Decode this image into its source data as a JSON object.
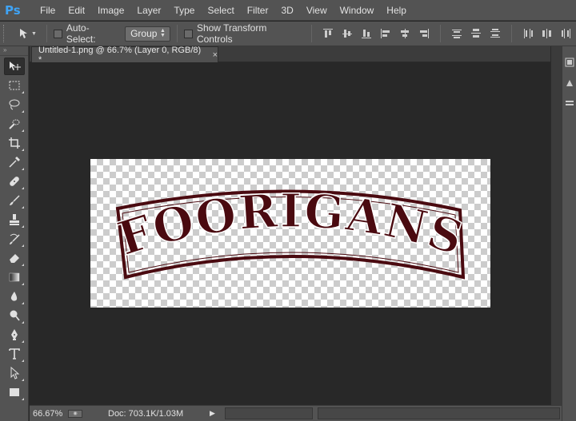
{
  "app": {
    "logo": "Ps"
  },
  "menu": [
    "File",
    "Edit",
    "Image",
    "Layer",
    "Type",
    "Select",
    "Filter",
    "3D",
    "View",
    "Window",
    "Help"
  ],
  "options": {
    "auto_select_label": "Auto-Select:",
    "auto_select_checked": false,
    "group_value": "Group",
    "transform_label": "Show Transform Controls",
    "transform_checked": false
  },
  "document": {
    "tab_title": "Untitled-1.png @ 66.7% (Layer 0, RGB/8) *",
    "close_glyph": "×",
    "artwork_text": "FOORIGANS",
    "artwork_color": "#4a0a10"
  },
  "status": {
    "zoom": "66.67%",
    "doc_info": "Doc: 703.1K/1.03M",
    "arrow": "▶"
  },
  "tools": [
    "move-tool-icon",
    "marquee-tool-icon",
    "lasso-tool-icon",
    "quick-selection-tool-icon",
    "crop-tool-icon",
    "eyedropper-tool-icon",
    "healing-brush-tool-icon",
    "brush-tool-icon",
    "clone-stamp-tool-icon",
    "history-brush-tool-icon",
    "eraser-tool-icon",
    "gradient-tool-icon",
    "blur-tool-icon",
    "dodge-tool-icon",
    "pen-tool-icon",
    "type-tool-icon",
    "path-selection-tool-icon",
    "rectangle-tool-icon"
  ]
}
